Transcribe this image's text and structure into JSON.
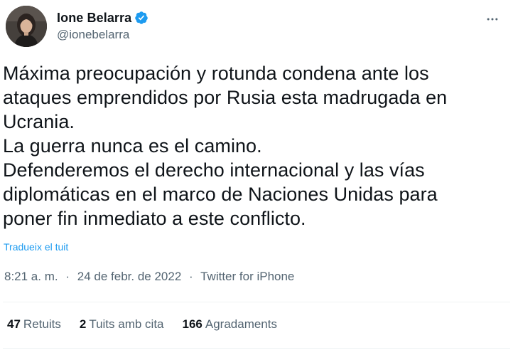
{
  "author": {
    "display_name": "Ione Belarra",
    "handle": "@ionebelarra",
    "verified_icon": "verified-badge-icon",
    "avatar_icon": "avatar-portrait"
  },
  "tweet": {
    "text": "Máxima preocupación y rotunda condena ante los\nataques emprendidos por Rusia esta madrugada en\nUcrania.\nLa guerra nunca es el camino.\nDefenderemos el derecho internacional y las vías\ndiplomáticas en el marco de Naciones Unidas para\nponer fin inmediato a este conflicto.",
    "translate_label": "Tradueix el tuit"
  },
  "meta": {
    "time": "8:21 a. m.",
    "separator": "·",
    "date": "24 de febr. de 2022",
    "source": "Twitter for iPhone"
  },
  "stats": [
    {
      "count": "47",
      "label": "Retuits"
    },
    {
      "count": "2",
      "label": "Tuits amb cita"
    },
    {
      "count": "166",
      "label": "Agradaments"
    }
  ],
  "colors": {
    "text_primary": "#0f1419",
    "text_secondary": "#536471",
    "link_blue": "#1d9bf0",
    "divider": "#eff3f4"
  },
  "icons": {
    "more": "more-dots-icon"
  }
}
